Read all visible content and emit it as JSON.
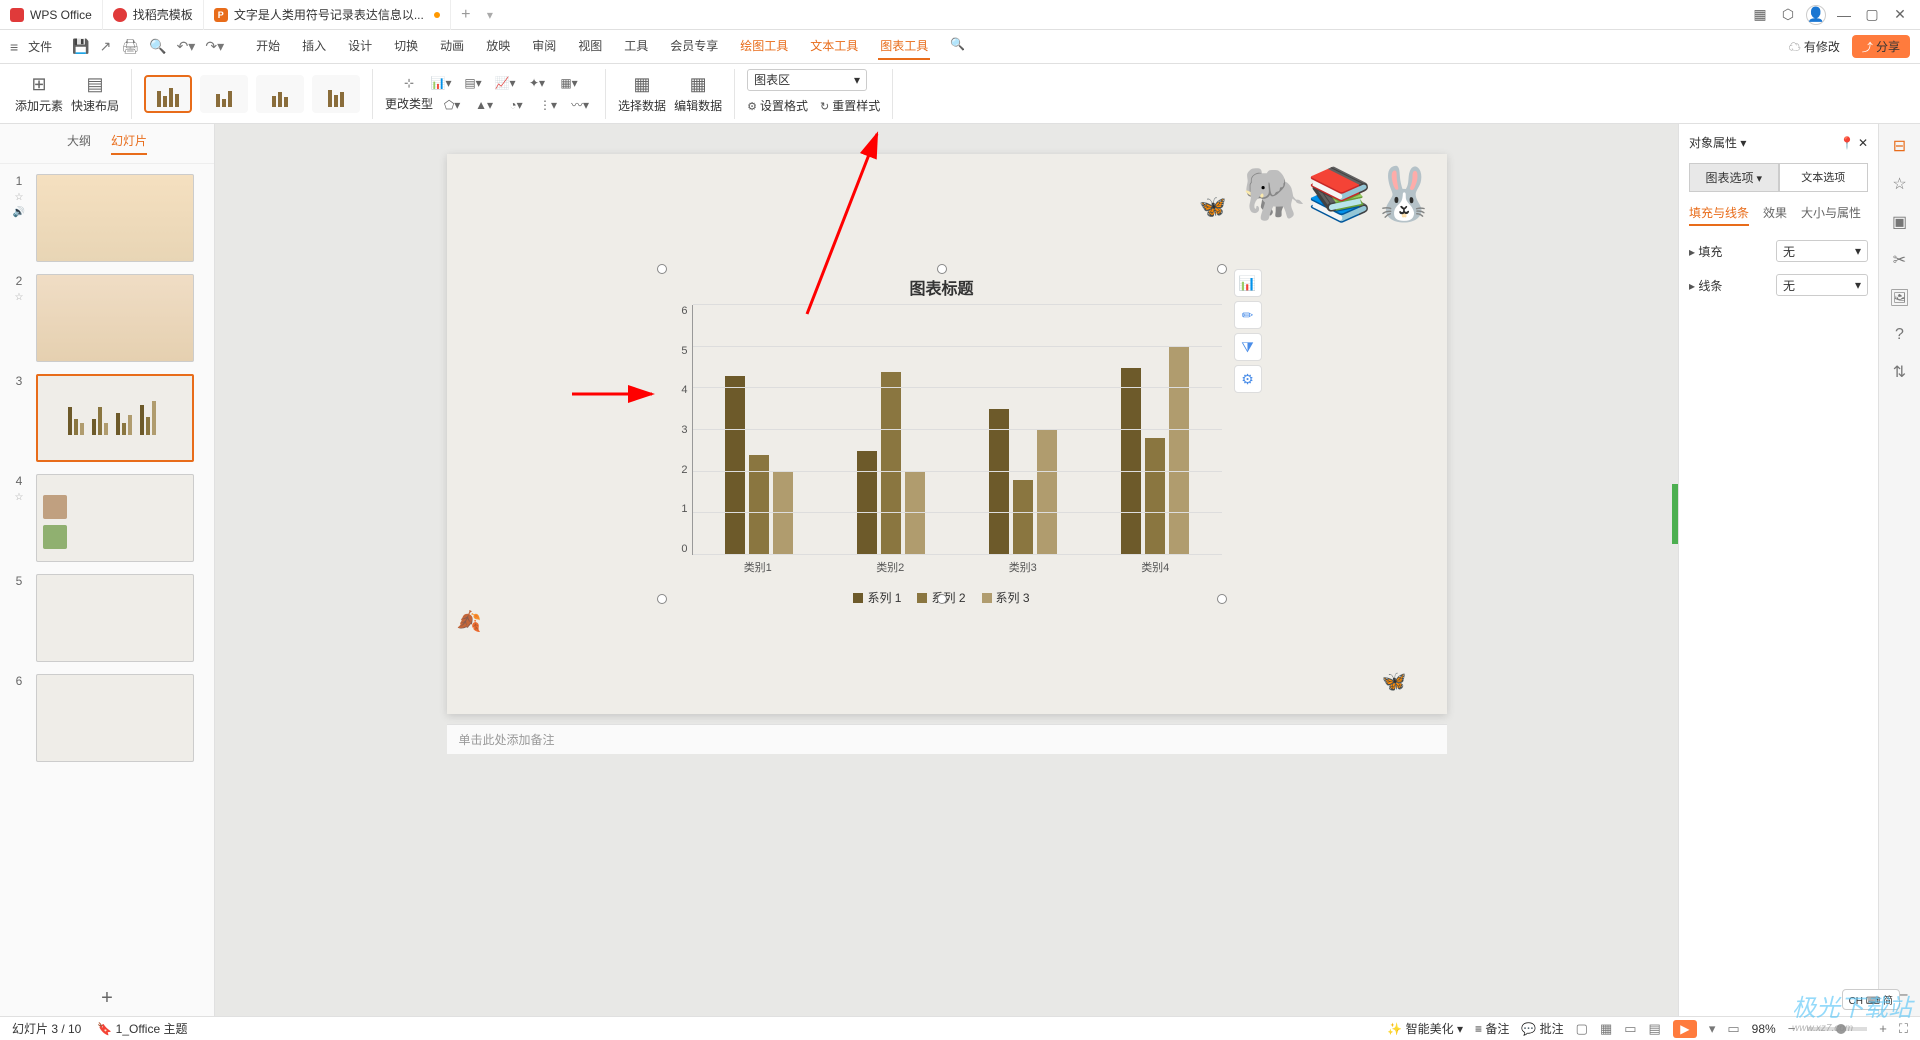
{
  "title_tabs": {
    "app": "WPS Office",
    "tab2": "找稻壳模板",
    "tab3": "文字是人类用符号记录表达信息以..."
  },
  "menu": {
    "file": "文件",
    "tabs": [
      "开始",
      "插入",
      "设计",
      "切换",
      "动画",
      "放映",
      "审阅",
      "视图",
      "工具",
      "会员专享"
    ],
    "orange_tabs": [
      "绘图工具",
      "文本工具"
    ],
    "active_tab": "图表工具",
    "has_changes": "有修改",
    "share": "分享"
  },
  "ribbon": {
    "add_element": "添加元素",
    "quick_layout": "快速布局",
    "change_type": "更改类型",
    "select_data": "选择数据",
    "edit_data": "编辑数据",
    "set_format": "设置格式",
    "reset_style": "重置样式",
    "area_select": "图表区"
  },
  "left_panel": {
    "tab_outline": "大纲",
    "tab_slides": "幻灯片"
  },
  "slide_notes": "单击此处添加备注",
  "right_panel": {
    "title": "对象属性",
    "tab_chart": "图表选项",
    "tab_text": "文本选项",
    "sub_fill": "填充与线条",
    "sub_effect": "效果",
    "sub_size": "大小与属性",
    "fill_label": "填充",
    "line_label": "线条",
    "none": "无"
  },
  "status": {
    "slide_pos": "幻灯片 3 / 10",
    "theme": "1_Office 主题",
    "smart_beauty": "智能美化",
    "notes": "备注",
    "comments": "批注",
    "zoom": "98%",
    "ime": "CH ⌨ 简"
  },
  "chart_data": {
    "type": "bar",
    "title": "图表标题",
    "categories": [
      "类别1",
      "类别2",
      "类别3",
      "类别4"
    ],
    "series": [
      {
        "name": "系列 1",
        "values": [
          4.3,
          2.5,
          3.5,
          4.5
        ],
        "color": "#6d5a2a"
      },
      {
        "name": "系列 2",
        "values": [
          2.4,
          4.4,
          1.8,
          2.8
        ],
        "color": "#8a7640"
      },
      {
        "name": "系列 3",
        "values": [
          2.0,
          2.0,
          3.0,
          5.0
        ],
        "color": "#b09c6e"
      }
    ],
    "ylim": [
      0,
      6
    ],
    "yticks": [
      0,
      1,
      2,
      3,
      4,
      5,
      6
    ]
  }
}
